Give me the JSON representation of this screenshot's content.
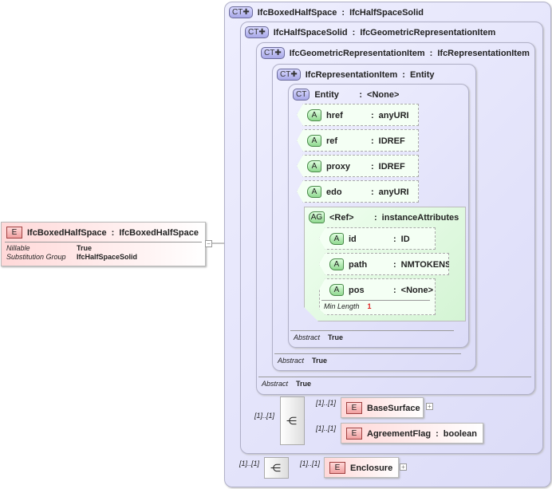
{
  "root": {
    "name": "IfcBoxedHalfSpace",
    "type": "IfcBoxedHalfSpace",
    "badge": "E",
    "props": [
      {
        "label": "Nillable",
        "value": "True"
      },
      {
        "label": "Substitution Group",
        "value": "IfcHalfSpaceSolid"
      }
    ],
    "toggle": "−"
  },
  "types": [
    {
      "badge": "CT",
      "name": "IfcBoxedHalfSpace",
      "base": "IfcHalfSpaceSolid"
    },
    {
      "badge": "CT",
      "name": "IfcHalfSpaceSolid",
      "base": "IfcGeometricRepresentationItem"
    },
    {
      "badge": "CT",
      "name": "IfcGeometricRepresentationItem",
      "base": "IfcRepresentationItem",
      "abstract_label": "Abstract",
      "abstract_value": "True"
    },
    {
      "badge": "CT",
      "name": "IfcRepresentationItem",
      "base": "Entity",
      "abstract_label": "Abstract",
      "abstract_value": "True"
    },
    {
      "badge": "CT",
      "name": "Entity",
      "base": "<None>",
      "abstract_label": "Abstract",
      "abstract_value": "True"
    }
  ],
  "attributes": [
    {
      "badge": "A",
      "name": "href",
      "type": "anyURI"
    },
    {
      "badge": "A",
      "name": "ref",
      "type": "IDREF"
    },
    {
      "badge": "A",
      "name": "proxy",
      "type": "IDREF"
    },
    {
      "badge": "A",
      "name": "edo",
      "type": "anyURI"
    }
  ],
  "attr_group": {
    "badge": "AG",
    "name": "<Ref>",
    "type": "instanceAttributes",
    "attributes": [
      {
        "badge": "A",
        "name": "id",
        "type": "ID"
      },
      {
        "badge": "A",
        "name": "path",
        "type": "NMTOKENS"
      },
      {
        "badge": "A",
        "name": "pos",
        "type": "<None>",
        "facet_label": "Min Length",
        "facet_value": "1"
      }
    ]
  },
  "elements": [
    {
      "badge": "E",
      "name": "BaseSurface",
      "card": "[1]..[1]",
      "expand": "+"
    },
    {
      "badge": "E",
      "name": "AgreementFlag",
      "type": "boolean",
      "card": "[1]..[1]"
    },
    {
      "badge": "E",
      "name": "Enclosure",
      "card": "[1]..[1]",
      "expand": "+"
    }
  ],
  "sequences": [
    {
      "card": "[1]..[1]"
    },
    {
      "card": "[1]..[1]"
    }
  ],
  "sep": ":"
}
